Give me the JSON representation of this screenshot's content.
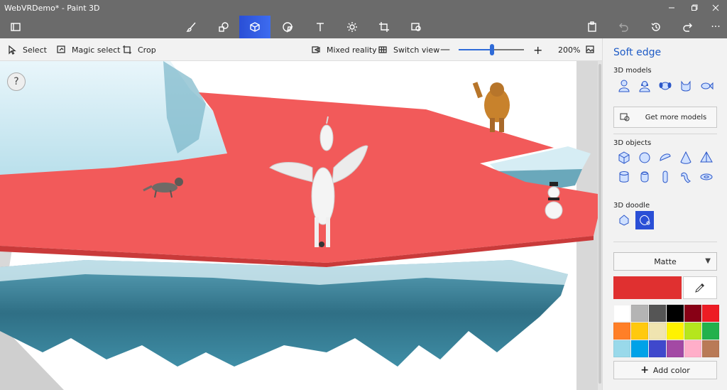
{
  "window": {
    "title": "WebVRDemo* - Paint 3D",
    "controls": [
      "minimize",
      "maximize",
      "close"
    ]
  },
  "main_toolbar": {
    "tools": [
      {
        "name": "menu",
        "icon": "folder-icon"
      },
      {
        "name": "brushes",
        "icon": "brush-icon"
      },
      {
        "name": "2d-shapes",
        "icon": "shapes-2d-icon"
      },
      {
        "name": "3d-shapes",
        "icon": "cube-icon",
        "active": true
      },
      {
        "name": "stickers",
        "icon": "sticker-icon"
      },
      {
        "name": "text",
        "icon": "text-icon"
      },
      {
        "name": "effects",
        "icon": "sun-icon"
      },
      {
        "name": "canvas",
        "icon": "canvas-crop-icon"
      },
      {
        "name": "remix-3d",
        "icon": "remix-icon"
      }
    ],
    "right_tools": [
      "paste-icon",
      "undo-icon",
      "history-icon",
      "redo-icon",
      "more-icon"
    ],
    "more_label": "···"
  },
  "command_bar": {
    "select_label": "Select",
    "magic_select_label": "Magic select",
    "crop_label": "Crop",
    "mixed_reality_label": "Mixed reality",
    "switch_view_label": "Switch view",
    "zoom_minus": "—",
    "zoom_plus": "+",
    "zoom_level": "200%",
    "zoom_fraction": 0.52
  },
  "canvas": {
    "help_label": "?"
  },
  "side_panel": {
    "title": "Soft edge",
    "models_label": "3D models",
    "models": [
      "person-icon",
      "woman-icon",
      "dog-icon",
      "cat-icon",
      "fish-icon"
    ],
    "get_more_label": "Get more models",
    "objects_label": "3D objects",
    "objects": [
      "cube-icon",
      "sphere-icon",
      "hemisphere-icon",
      "cone-icon",
      "pyramid-icon",
      "cylinder-icon",
      "tube-icon",
      "capsule-icon",
      "torus-curve-icon",
      "donut-icon"
    ],
    "doodle_label": "3D doodle",
    "doodles": [
      "sharp-edge-doodle-icon",
      "soft-edge-doodle-icon"
    ],
    "material_label": "Matte",
    "current_color": "#e03030",
    "palette": [
      "#ffffff",
      "#b4b4b4",
      "#555555",
      "#000000",
      "#880015",
      "#ed1c24",
      "#ff7f27",
      "#ffc90e",
      "#efe4b0",
      "#fff200",
      "#b5e61d",
      "#22b14c",
      "#99d9ea",
      "#00a2e8",
      "#3f48cc",
      "#a349a4",
      "#ffaec9",
      "#b97a57"
    ],
    "add_color_label": "Add color"
  }
}
